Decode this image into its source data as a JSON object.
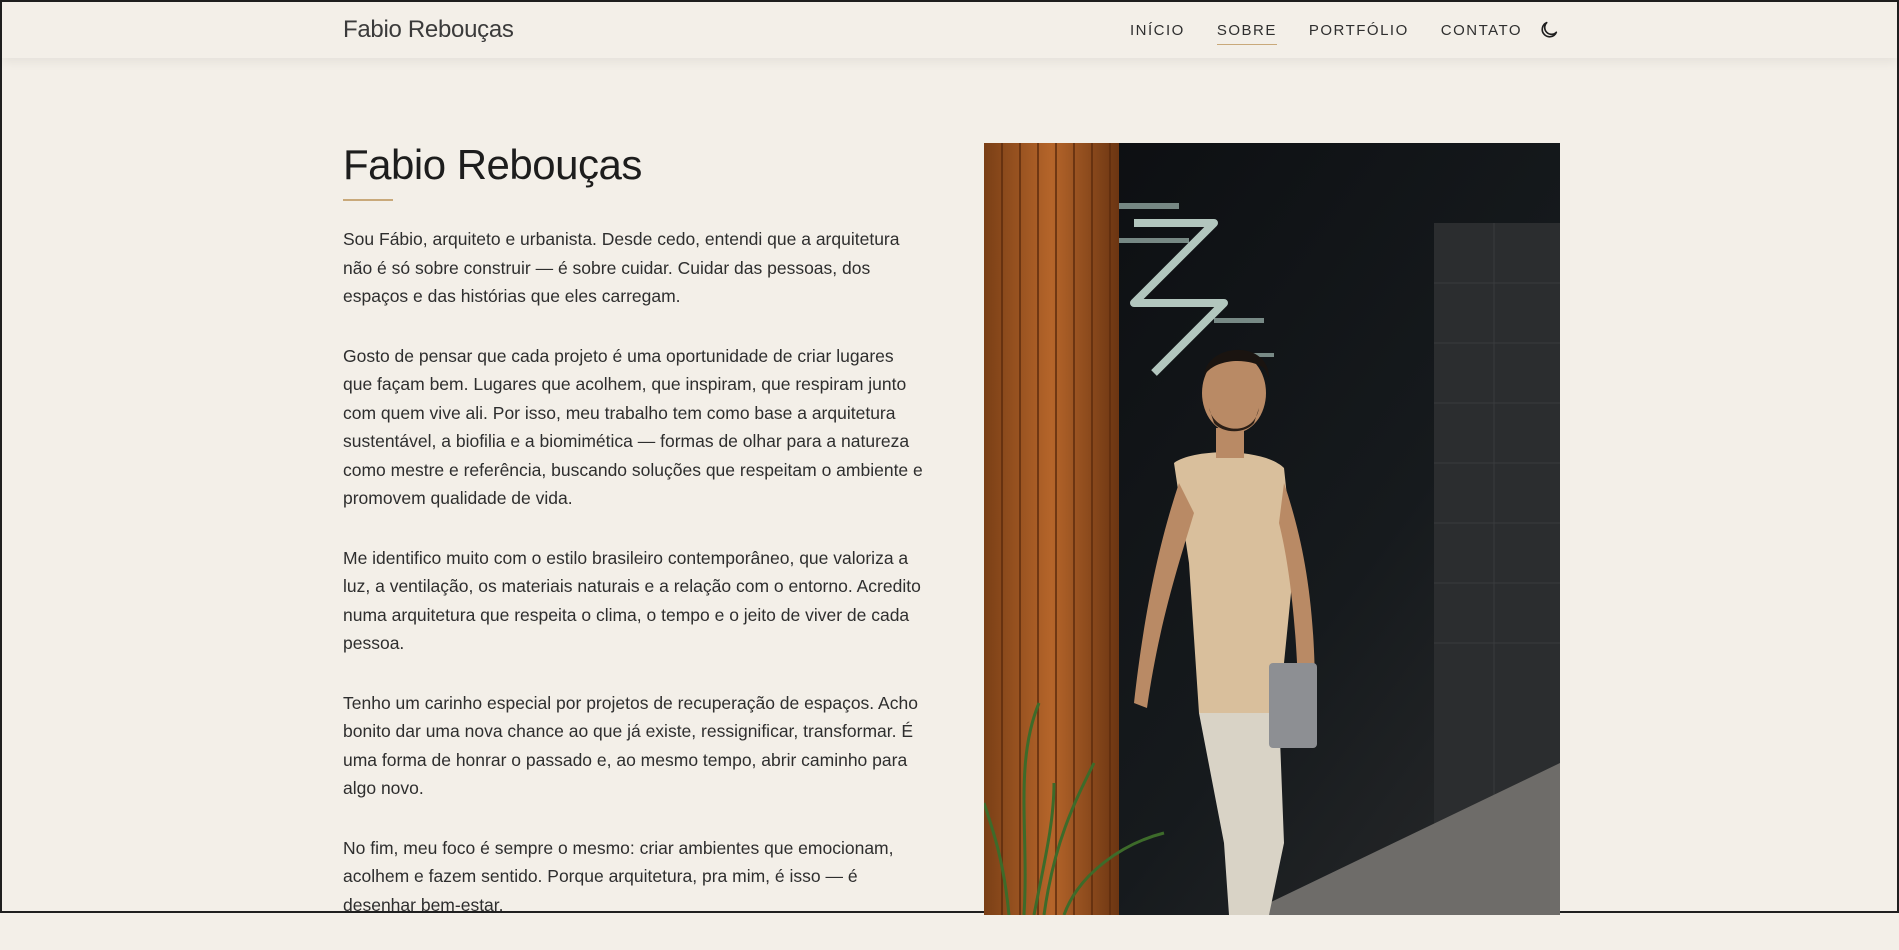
{
  "header": {
    "brand": "Fabio Rebouças",
    "nav": [
      {
        "label": "INÍCIO",
        "active": false
      },
      {
        "label": "SOBRE",
        "active": true
      },
      {
        "label": "PORTFÓLIO",
        "active": false
      },
      {
        "label": "CONTATO",
        "active": false
      }
    ],
    "theme_icon": "moon-icon"
  },
  "about": {
    "title": "Fabio Rebouças",
    "paragraphs": [
      "Sou Fábio, arquiteto e urbanista. Desde cedo, entendi que a arquitetura não é só sobre construir — é sobre cuidar. Cuidar das pessoas, dos espaços e das histórias que eles carregam.",
      "Gosto de pensar que cada projeto é uma oportunidade de criar lugares que façam bem. Lugares que acolhem, que inspiram, que respiram junto com quem vive ali. Por isso, meu trabalho tem como base a arquitetura sustentável, a biofilia e a biomimética — formas de olhar para a natureza como mestre e referência, buscando soluções que respeitam o ambiente e promovem qualidade de vida.",
      "Me identifico muito com o estilo brasileiro contemporâneo, que valoriza a luz, a ventilação, os materiais naturais e a relação com o entorno. Acredito numa arquitetura que respeita o clima, o tempo e o jeito de viver de cada pessoa.",
      "Tenho um carinho especial por projetos de recuperação de espaços. Acho bonito dar uma nova chance ao que já existe, ressignificar, transformar. É uma forma de honrar o passado e, ao mesmo tempo, abrir caminho para algo novo.",
      "No fim, meu foco é sempre o mesmo: criar ambientes que emocionam, acolhem e fazem sentido. Porque arquitetura, pra mim, é isso — é desenhar bem-estar."
    ]
  },
  "colors": {
    "background": "#f3efe8",
    "accent": "#c9a97a",
    "text": "#2e2e2e"
  }
}
